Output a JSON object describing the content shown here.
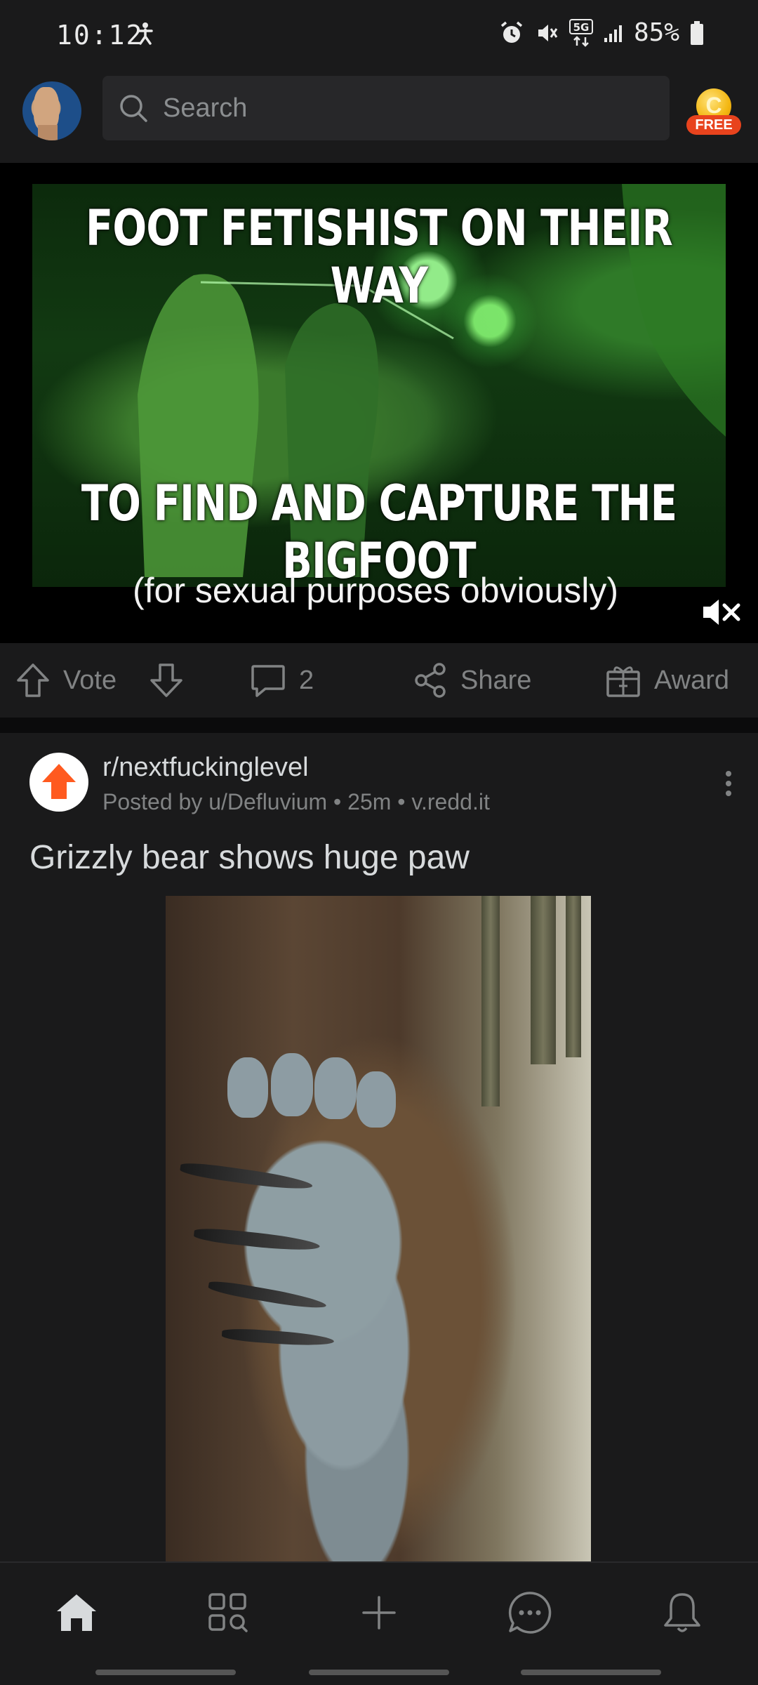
{
  "status_bar": {
    "time": "10:12",
    "battery": "85%",
    "network": "5G"
  },
  "header": {
    "search_placeholder": "Search",
    "coin_letter": "C",
    "free_label": "FREE"
  },
  "video_post": {
    "meme_top_text": "FOOT FETISHIST ON THEIR WAY",
    "meme_bottom_text": "TO FIND AND CAPTURE THE BIGFOOT",
    "caption": "(for sexual purposes obviously)",
    "actions": {
      "vote_label": "Vote",
      "comment_count": "2",
      "share_label": "Share",
      "award_label": "Award"
    }
  },
  "post2": {
    "subreddit": "r/nextfuckinglevel",
    "meta": "Posted by u/Defluvium • 25m • v.redd.it",
    "title": "Grizzly bear shows huge paw"
  },
  "icons": {
    "search": "search-icon",
    "mute": "muted-speaker-icon",
    "upvote": "upvote-arrow-icon",
    "downvote": "downvote-arrow-icon",
    "comment": "comment-bubble-icon",
    "share": "share-icon",
    "award": "gift-award-icon",
    "more": "vertical-dots-icon",
    "home": "home-icon",
    "discover": "grid-search-icon",
    "create": "plus-icon",
    "chat": "chat-bubble-icon",
    "notifications": "bell-icon"
  },
  "colors": {
    "background": "#0e0e0f",
    "surface": "#1a1a1b",
    "text_primary": "#d7dadc",
    "text_secondary": "#818384",
    "accent_orange": "#ff4500",
    "free_badge": "#e8431d",
    "coin_gold": "#f3b712"
  }
}
